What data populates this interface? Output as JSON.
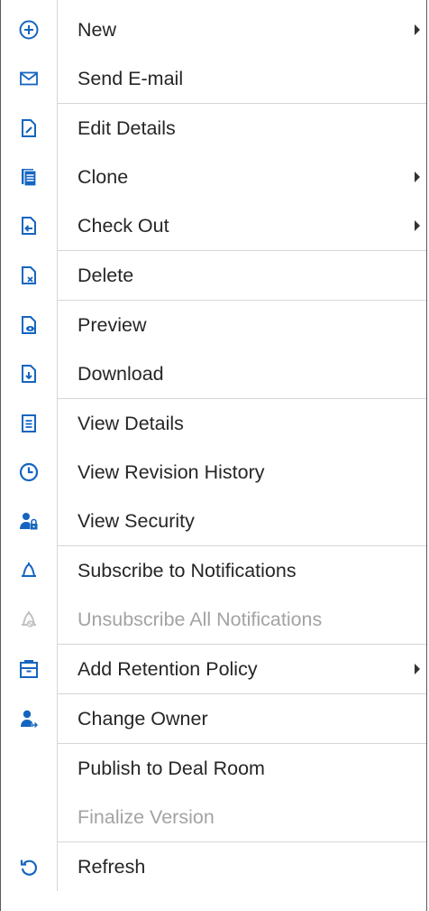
{
  "colors": {
    "icon_blue": "#1565c0",
    "disabled_gray": "#c2c2c2",
    "text": "#262626",
    "text_disabled": "#a3a3a3"
  },
  "menu": {
    "items": [
      {
        "label": "New",
        "icon": "plus-circle-icon",
        "submenu": true,
        "disabled": false
      },
      {
        "label": "Send E-mail",
        "icon": "envelope-icon",
        "submenu": false,
        "disabled": false
      },
      {
        "label": "Edit Details",
        "icon": "document-edit-icon",
        "submenu": false,
        "disabled": false
      },
      {
        "label": "Clone",
        "icon": "document-clone-icon",
        "submenu": true,
        "disabled": false
      },
      {
        "label": "Check Out",
        "icon": "document-checkout-icon",
        "submenu": true,
        "disabled": false
      },
      {
        "label": "Delete",
        "icon": "document-delete-icon",
        "submenu": false,
        "disabled": false
      },
      {
        "label": "Preview",
        "icon": "document-preview-icon",
        "submenu": false,
        "disabled": false
      },
      {
        "label": "Download",
        "icon": "document-download-icon",
        "submenu": false,
        "disabled": false
      },
      {
        "label": "View Details",
        "icon": "details-list-icon",
        "submenu": false,
        "disabled": false
      },
      {
        "label": "View Revision History",
        "icon": "clock-icon",
        "submenu": false,
        "disabled": false
      },
      {
        "label": "View Security",
        "icon": "user-lock-icon",
        "submenu": false,
        "disabled": false
      },
      {
        "label": "Subscribe to Notifications",
        "icon": "bell-icon",
        "submenu": false,
        "disabled": false
      },
      {
        "label": "Unsubscribe All Notifications",
        "icon": "bell-off-icon",
        "submenu": false,
        "disabled": true
      },
      {
        "label": "Add Retention Policy",
        "icon": "retention-box-icon",
        "submenu": true,
        "disabled": false
      },
      {
        "label": "Change Owner",
        "icon": "user-change-icon",
        "submenu": false,
        "disabled": false
      },
      {
        "label": "Publish to Deal Room",
        "icon": "",
        "submenu": false,
        "disabled": false
      },
      {
        "label": "Finalize Version",
        "icon": "",
        "submenu": false,
        "disabled": true
      },
      {
        "label": "Refresh",
        "icon": "refresh-icon",
        "submenu": false,
        "disabled": false
      }
    ]
  }
}
